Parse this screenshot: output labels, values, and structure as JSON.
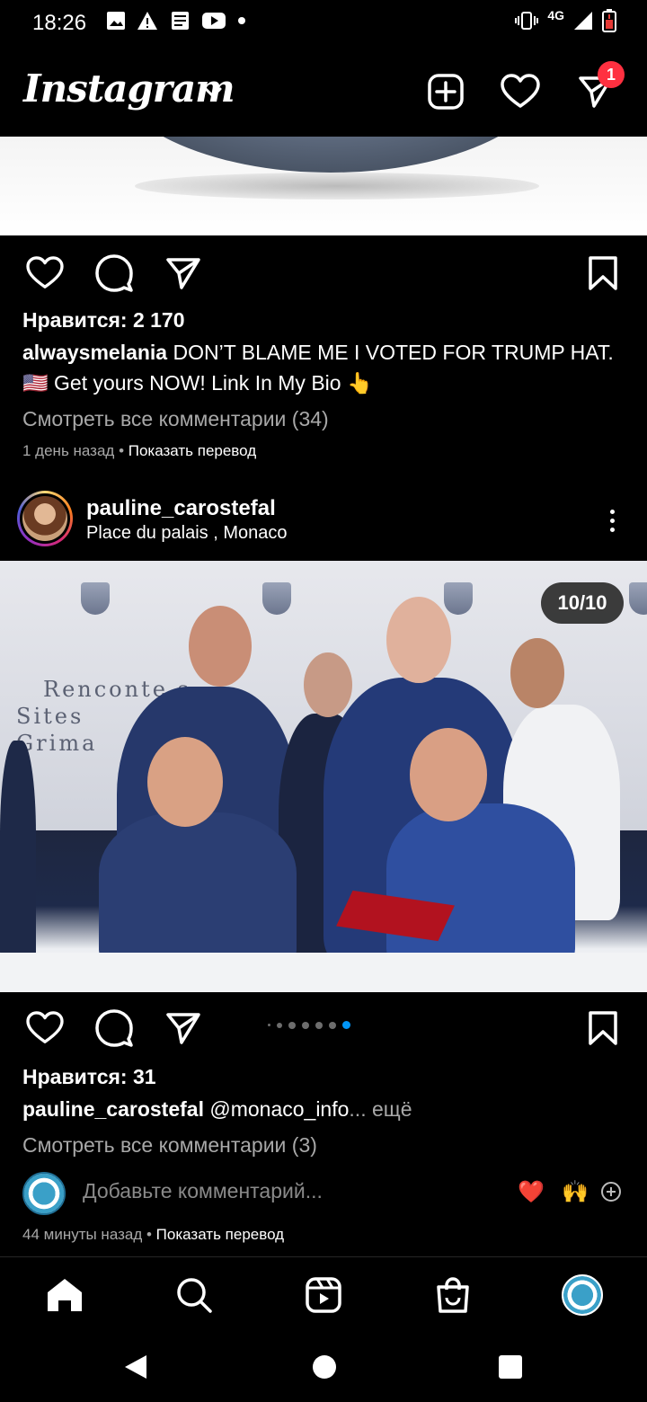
{
  "status_bar": {
    "time": "18:26",
    "network": "4G",
    "left_icons": [
      "gallery-icon",
      "warning-icon",
      "news-icon",
      "youtube-icon",
      "dot-icon"
    ],
    "right_icons": [
      "vibrate-icon",
      "signal-icon",
      "battery-low-icon"
    ]
  },
  "header": {
    "logo": "Instagram",
    "dm_badge": "1",
    "icons": [
      "create-post-icon",
      "heart-icon",
      "direct-message-icon"
    ]
  },
  "post1": {
    "likes": "Нравится: 2 170",
    "author": "alwaysmelania",
    "caption": " DON’T BLAME ME I VOTED FOR TRUMP HAT.",
    "caption_line2": "🇺🇸 Get yours NOW! Link In My Bio 👆",
    "view_comments": "Смотреть все комментарии (34)",
    "time": "1 день назад",
    "separator": " • ",
    "translate": "Показать перевод"
  },
  "post2": {
    "username": "pauline_carostefal",
    "location": "Place du palais , Monaco",
    "counter": "10/10",
    "banner_text": [
      "Renconte     s",
      "Sites",
      "Grima"
    ],
    "likes": "Нравится: 31",
    "author": "pauline_carostefal",
    "caption": " @monaco_info",
    "caption_more": "... ещё",
    "view_comments": "Смотреть все комментарии (3)",
    "add_comment_placeholder": "Добавьте комментарий...",
    "quick_emojis": [
      "❤️",
      "🙌"
    ],
    "time": "44 минуты назад",
    "separator": " • ",
    "translate": "Показать перевод",
    "carousel_total": 10,
    "carousel_active": 10
  },
  "bottom_nav": [
    "home-icon",
    "search-icon",
    "reels-icon",
    "shop-icon",
    "profile-avatar"
  ],
  "system_nav": [
    "back-icon",
    "home-circle-icon",
    "recents-icon"
  ]
}
